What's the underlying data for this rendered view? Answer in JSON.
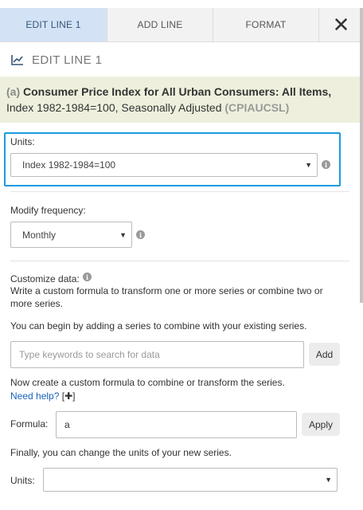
{
  "tabs": [
    {
      "label": "EDIT LINE 1",
      "active": true
    },
    {
      "label": "ADD LINE",
      "active": false
    },
    {
      "label": "FORMAT",
      "active": false
    }
  ],
  "close_icon": "close-icon",
  "header": {
    "title": "EDIT LINE 1",
    "icon": "line-chart-icon"
  },
  "series": {
    "letter": "(a)",
    "name": "Consumer Price Index for All Urban Consumers: All Items,",
    "detail": "Index 1982-1984=100, Seasonally Adjusted",
    "code": "(CPIAUCSL)"
  },
  "units": {
    "label": "Units:",
    "value": "Index 1982-1984=100"
  },
  "frequency": {
    "label": "Modify frequency:",
    "value": "Monthly"
  },
  "customize": {
    "label": "Customize data:",
    "description": "Write a custom formula to transform one or more series or combine two or more series.",
    "begin_text": "You can begin by adding a series to combine with your existing series.",
    "search_placeholder": "Type keywords to search for data",
    "add_label": "Add",
    "formula_intro": "Now create a custom formula to combine or transform the series.",
    "help_link": "Need help?",
    "help_toggle": "[✚]",
    "formula_label": "Formula:",
    "formula_value": "a",
    "apply_label": "Apply",
    "final_text": "Finally, you can change the units of your new series.",
    "units_label": "Units:",
    "units_value": ""
  },
  "colors": {
    "accent": "#1a9be0",
    "active_tab": "#d3e3f5",
    "series_bg": "#eef0dd",
    "link": "#1a62b8"
  }
}
